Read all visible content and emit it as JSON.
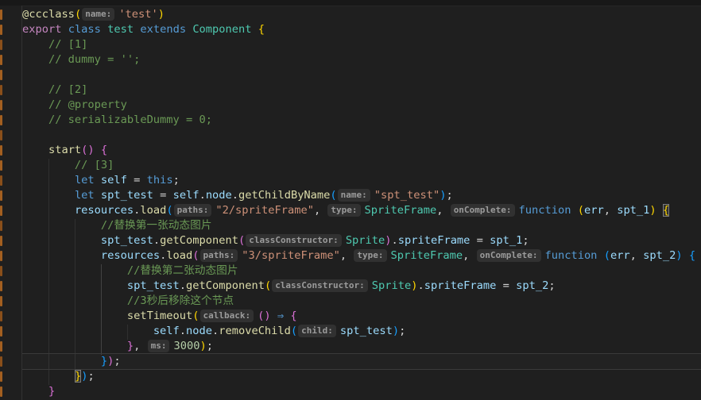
{
  "editor": {
    "palette": {
      "background": "#1f1f1f",
      "top_strip": "#181818",
      "gutter_border": "#323232",
      "git_modified_marker": "#a35f20",
      "keyword": "#569cd6",
      "control_keyword": "#c586c0",
      "function": "#dcdcaa",
      "type": "#4ec9b0",
      "variable": "#9cdcfe",
      "string": "#ce9178",
      "number": "#b5cea8",
      "comment": "#6a9955",
      "bracket_gold": "#ffd700",
      "bracket_orchid": "#da70d6",
      "bracket_blue": "#179fff",
      "inlay_bg": "#313131",
      "inlay_fg": "#9b9b9b"
    },
    "current_line": 24,
    "gutter": {
      "marker_rows": [
        1,
        2,
        3,
        4,
        5,
        6,
        7,
        8,
        9,
        10,
        11,
        12,
        13,
        14,
        15,
        16,
        17,
        18,
        19,
        20,
        21,
        22,
        23,
        24,
        25,
        26
      ]
    },
    "code": {
      "lines": [
        {
          "tokens": [
            {
              "t": "@ccclass",
              "c": "fn"
            },
            {
              "t": "(",
              "c": "b1"
            },
            {
              "t": "name:",
              "c": "inlay"
            },
            {
              "t": "'test'",
              "c": "str"
            },
            {
              "t": ")",
              "c": "b1"
            }
          ]
        },
        {
          "tokens": [
            {
              "t": "export",
              "c": "ctrl"
            },
            {
              "t": " ",
              "c": "pln"
            },
            {
              "t": "class",
              "c": "kw"
            },
            {
              "t": " ",
              "c": "pln"
            },
            {
              "t": "test",
              "c": "type"
            },
            {
              "t": " ",
              "c": "pln"
            },
            {
              "t": "extends",
              "c": "kw"
            },
            {
              "t": " ",
              "c": "pln"
            },
            {
              "t": "Component",
              "c": "type"
            },
            {
              "t": " ",
              "c": "pln"
            },
            {
              "t": "{",
              "c": "b1"
            }
          ]
        },
        {
          "tokens": [
            {
              "t": "    // [1]",
              "c": "cmt"
            }
          ]
        },
        {
          "tokens": [
            {
              "t": "    // dummy = '';",
              "c": "cmt"
            }
          ]
        },
        {
          "tokens": []
        },
        {
          "tokens": [
            {
              "t": "    // [2]",
              "c": "cmt"
            }
          ]
        },
        {
          "tokens": [
            {
              "t": "    // @property",
              "c": "cmt"
            }
          ]
        },
        {
          "tokens": [
            {
              "t": "    // serializableDummy = 0;",
              "c": "cmt"
            }
          ]
        },
        {
          "tokens": []
        },
        {
          "tokens": [
            {
              "t": "    ",
              "c": "pln"
            },
            {
              "t": "start",
              "c": "fn"
            },
            {
              "t": "()",
              "c": "b2"
            },
            {
              "t": " ",
              "c": "pln"
            },
            {
              "t": "{",
              "c": "b2"
            }
          ]
        },
        {
          "tokens": [
            {
              "t": "        // [3]",
              "c": "cmt"
            }
          ]
        },
        {
          "tokens": [
            {
              "t": "        ",
              "c": "pln"
            },
            {
              "t": "let",
              "c": "kw"
            },
            {
              "t": " ",
              "c": "pln"
            },
            {
              "t": "self",
              "c": "var"
            },
            {
              "t": " = ",
              "c": "pln"
            },
            {
              "t": "this",
              "c": "kw"
            },
            {
              "t": ";",
              "c": "pln"
            }
          ]
        },
        {
          "tokens": [
            {
              "t": "        ",
              "c": "pln"
            },
            {
              "t": "let",
              "c": "kw"
            },
            {
              "t": " ",
              "c": "pln"
            },
            {
              "t": "spt_test",
              "c": "var"
            },
            {
              "t": " = ",
              "c": "pln"
            },
            {
              "t": "self",
              "c": "var"
            },
            {
              "t": ".",
              "c": "pln"
            },
            {
              "t": "node",
              "c": "var"
            },
            {
              "t": ".",
              "c": "pln"
            },
            {
              "t": "getChildByName",
              "c": "fn"
            },
            {
              "t": "(",
              "c": "b3"
            },
            {
              "t": "name:",
              "c": "inlay"
            },
            {
              "t": "\"spt_test\"",
              "c": "str"
            },
            {
              "t": ")",
              "c": "b3"
            },
            {
              "t": ";",
              "c": "pln"
            }
          ]
        },
        {
          "tokens": [
            {
              "t": "        ",
              "c": "pln"
            },
            {
              "t": "resources",
              "c": "var"
            },
            {
              "t": ".",
              "c": "pln"
            },
            {
              "t": "load",
              "c": "fn"
            },
            {
              "t": "(",
              "c": "b3"
            },
            {
              "t": "paths:",
              "c": "inlay"
            },
            {
              "t": "\"2/spriteFrame\"",
              "c": "str"
            },
            {
              "t": ", ",
              "c": "pln"
            },
            {
              "t": "type:",
              "c": "inlay"
            },
            {
              "t": "SpriteFrame",
              "c": "type"
            },
            {
              "t": ", ",
              "c": "pln"
            },
            {
              "t": "onComplete:",
              "c": "inlay"
            },
            {
              "t": "function",
              "c": "kw"
            },
            {
              "t": " ",
              "c": "pln"
            },
            {
              "t": "(",
              "c": "b1"
            },
            {
              "t": "err",
              "c": "var"
            },
            {
              "t": ", ",
              "c": "pln"
            },
            {
              "t": "spt_1",
              "c": "var"
            },
            {
              "t": ")",
              "c": "b1"
            },
            {
              "t": " ",
              "c": "pln"
            },
            {
              "t": "{",
              "c": "b1",
              "m": true
            }
          ]
        },
        {
          "tokens": [
            {
              "t": "            //替换第一张动态图片",
              "c": "cmt"
            }
          ]
        },
        {
          "tokens": [
            {
              "t": "            ",
              "c": "pln"
            },
            {
              "t": "spt_test",
              "c": "var"
            },
            {
              "t": ".",
              "c": "pln"
            },
            {
              "t": "getComponent",
              "c": "fn"
            },
            {
              "t": "(",
              "c": "b2"
            },
            {
              "t": "classConstructor:",
              "c": "inlay"
            },
            {
              "t": "Sprite",
              "c": "type"
            },
            {
              "t": ")",
              "c": "b2"
            },
            {
              "t": ".",
              "c": "pln"
            },
            {
              "t": "spriteFrame",
              "c": "var"
            },
            {
              "t": " = ",
              "c": "pln"
            },
            {
              "t": "spt_1",
              "c": "var"
            },
            {
              "t": ";",
              "c": "pln"
            }
          ]
        },
        {
          "tokens": [
            {
              "t": "            ",
              "c": "pln"
            },
            {
              "t": "resources",
              "c": "var"
            },
            {
              "t": ".",
              "c": "pln"
            },
            {
              "t": "load",
              "c": "fn"
            },
            {
              "t": "(",
              "c": "b2"
            },
            {
              "t": "paths:",
              "c": "inlay"
            },
            {
              "t": "\"3/spriteFrame\"",
              "c": "str"
            },
            {
              "t": ", ",
              "c": "pln"
            },
            {
              "t": "type:",
              "c": "inlay"
            },
            {
              "t": "SpriteFrame",
              "c": "type"
            },
            {
              "t": ", ",
              "c": "pln"
            },
            {
              "t": "onComplete:",
              "c": "inlay"
            },
            {
              "t": "function",
              "c": "kw"
            },
            {
              "t": " ",
              "c": "pln"
            },
            {
              "t": "(",
              "c": "b3"
            },
            {
              "t": "err",
              "c": "var"
            },
            {
              "t": ", ",
              "c": "pln"
            },
            {
              "t": "spt_2",
              "c": "var"
            },
            {
              "t": ")",
              "c": "b3"
            },
            {
              "t": " ",
              "c": "pln"
            },
            {
              "t": "{",
              "c": "b3"
            }
          ]
        },
        {
          "tokens": [
            {
              "t": "                //替换第二张动态图片",
              "c": "cmt"
            }
          ]
        },
        {
          "tokens": [
            {
              "t": "                ",
              "c": "pln"
            },
            {
              "t": "spt_test",
              "c": "var"
            },
            {
              "t": ".",
              "c": "pln"
            },
            {
              "t": "getComponent",
              "c": "fn"
            },
            {
              "t": "(",
              "c": "b1"
            },
            {
              "t": "classConstructor:",
              "c": "inlay"
            },
            {
              "t": "Sprite",
              "c": "type"
            },
            {
              "t": ")",
              "c": "b1"
            },
            {
              "t": ".",
              "c": "pln"
            },
            {
              "t": "spriteFrame",
              "c": "var"
            },
            {
              "t": " = ",
              "c": "pln"
            },
            {
              "t": "spt_2",
              "c": "var"
            },
            {
              "t": ";",
              "c": "pln"
            }
          ]
        },
        {
          "tokens": [
            {
              "t": "                //3秒后移除这个节点",
              "c": "cmt"
            }
          ]
        },
        {
          "tokens": [
            {
              "t": "                ",
              "c": "pln"
            },
            {
              "t": "setTimeout",
              "c": "fn"
            },
            {
              "t": "(",
              "c": "b1"
            },
            {
              "t": "callback:",
              "c": "inlay"
            },
            {
              "t": "()",
              "c": "b2"
            },
            {
              "t": " ",
              "c": "pln"
            },
            {
              "t": "⇒",
              "c": "kw"
            },
            {
              "t": " ",
              "c": "pln"
            },
            {
              "t": "{",
              "c": "b2"
            }
          ]
        },
        {
          "tokens": [
            {
              "t": "                    ",
              "c": "pln"
            },
            {
              "t": "self",
              "c": "var"
            },
            {
              "t": ".",
              "c": "pln"
            },
            {
              "t": "node",
              "c": "var"
            },
            {
              "t": ".",
              "c": "pln"
            },
            {
              "t": "removeChild",
              "c": "fn"
            },
            {
              "t": "(",
              "c": "b3"
            },
            {
              "t": "child:",
              "c": "inlay"
            },
            {
              "t": "spt_test",
              "c": "var"
            },
            {
              "t": ")",
              "c": "b3"
            },
            {
              "t": ";",
              "c": "pln"
            }
          ]
        },
        {
          "tokens": [
            {
              "t": "                ",
              "c": "pln"
            },
            {
              "t": "}",
              "c": "b2"
            },
            {
              "t": ", ",
              "c": "pln"
            },
            {
              "t": "ms:",
              "c": "inlay"
            },
            {
              "t": "3000",
              "c": "num"
            },
            {
              "t": ")",
              "c": "b1"
            },
            {
              "t": ";",
              "c": "pln"
            }
          ]
        },
        {
          "tokens": [
            {
              "t": "            ",
              "c": "pln"
            },
            {
              "t": "}",
              "c": "b3"
            },
            {
              "t": ")",
              "c": "b2"
            },
            {
              "t": ";",
              "c": "pln"
            }
          ]
        },
        {
          "tokens": [
            {
              "t": "        ",
              "c": "pln"
            },
            {
              "t": "}",
              "c": "b1",
              "m": true
            },
            {
              "t": ")",
              "c": "b3"
            },
            {
              "t": ";",
              "c": "pln"
            }
          ]
        },
        {
          "tokens": [
            {
              "t": "    ",
              "c": "pln"
            },
            {
              "t": "}",
              "c": "b2"
            }
          ]
        }
      ]
    }
  }
}
